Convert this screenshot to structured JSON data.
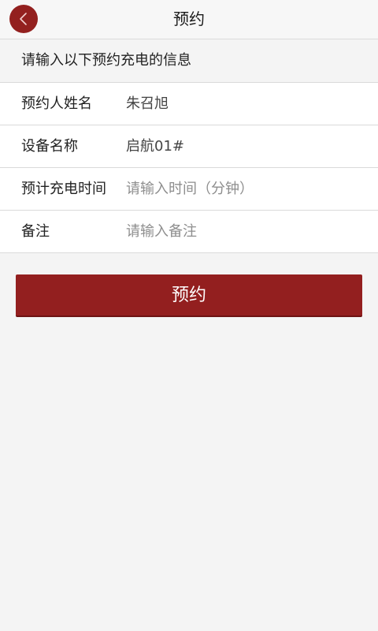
{
  "header": {
    "title": "预约",
    "back_icon": "chevron-left-icon",
    "accent_color": "#93201f"
  },
  "intro": "请输入以下预约充电的信息",
  "form": {
    "fields": [
      {
        "label": "预约人姓名",
        "value": "朱召旭",
        "placeholder": ""
      },
      {
        "label": "设备名称",
        "value": "启航01#",
        "placeholder": ""
      },
      {
        "label": "预计充电时间",
        "value": "",
        "placeholder": "请输入时间（分钟）"
      },
      {
        "label": "备注",
        "value": "",
        "placeholder": "请输入备注"
      }
    ]
  },
  "submit_label": "预约"
}
